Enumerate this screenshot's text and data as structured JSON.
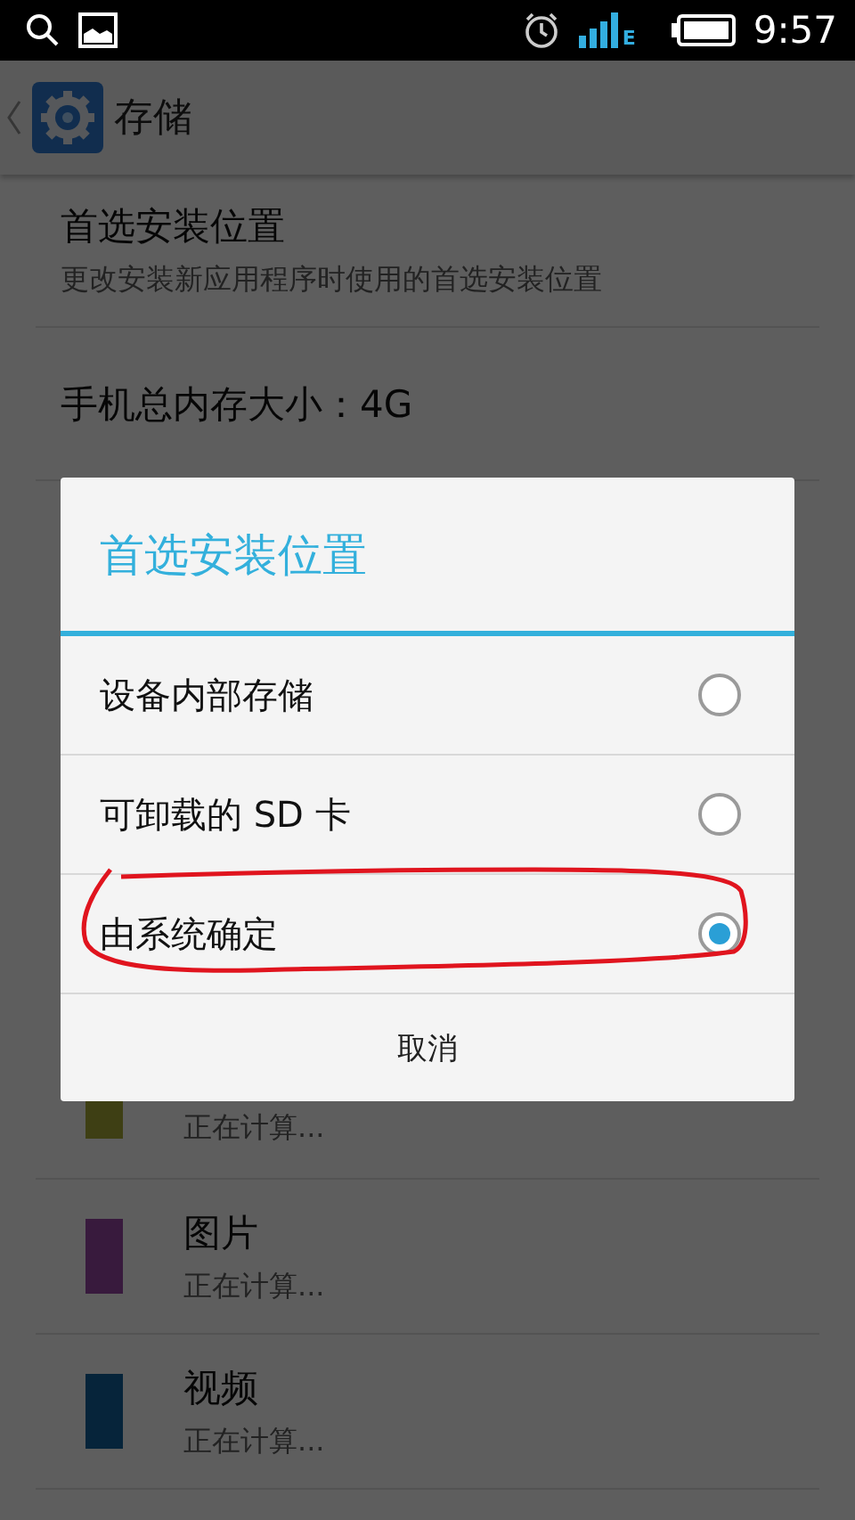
{
  "status_bar": {
    "time": "9:57",
    "network": "E"
  },
  "action_bar": {
    "title": "存储"
  },
  "settings": [
    {
      "title": "首选安装位置",
      "subtitle": "更改安装新应用程序时使用的首选安装位置"
    },
    {
      "title": "手机总内存大小：4G"
    }
  ],
  "storage_items": [
    {
      "subtitle": "正在计算...",
      "color": "#3e3f14"
    },
    {
      "title": "图片",
      "subtitle": "正在计算...",
      "color": "#381a3d"
    },
    {
      "title": "视频",
      "subtitle": "正在计算...",
      "color": "#06243a"
    }
  ],
  "dialog": {
    "title": "首选安装位置",
    "options": [
      {
        "label": "设备内部存储",
        "selected": false
      },
      {
        "label": "可卸载的 SD 卡",
        "selected": false
      },
      {
        "label": "由系统确定",
        "selected": true
      }
    ],
    "button": "取消"
  }
}
